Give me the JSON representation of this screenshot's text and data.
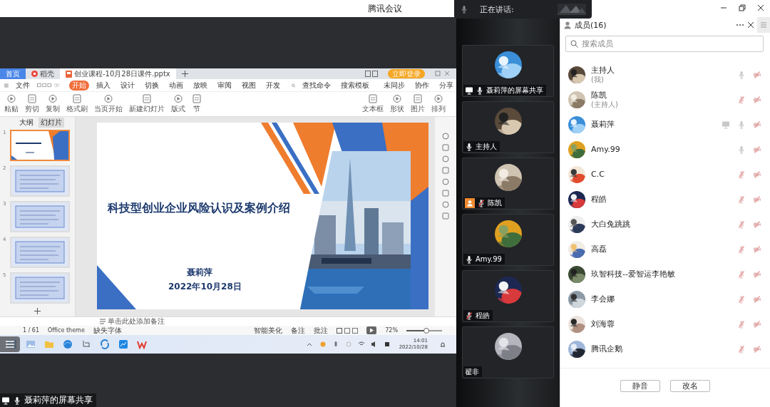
{
  "window": {
    "title": "腾讯会议",
    "speaking_label": "正在讲话:"
  },
  "share": {
    "label": "聂莉萍的屏幕共享",
    "tabs": [
      {
        "label": "首页",
        "kind": "home",
        "selected": false
      },
      {
        "label": "稻壳",
        "kind": "docer",
        "selected": false
      },
      {
        "label": "创业课程-10月28日课件.pptx",
        "kind": "file",
        "selected": true
      }
    ],
    "login_button": "立即登录",
    "menu": [
      {
        "label": "文件",
        "selected": false
      },
      {
        "label": "开始",
        "selected": true
      },
      {
        "label": "插入",
        "selected": false
      },
      {
        "label": "设计",
        "selected": false
      },
      {
        "label": "切换",
        "selected": false
      },
      {
        "label": "动画",
        "selected": false
      },
      {
        "label": "放映",
        "selected": false
      },
      {
        "label": "审阅",
        "selected": false
      },
      {
        "label": "视图",
        "selected": false
      },
      {
        "label": "开发",
        "selected": false
      }
    ],
    "search": [
      "查找命令",
      "搜索模板"
    ],
    "sync": [
      "未同步",
      "协作",
      "分享"
    ],
    "ribbon": [
      "粘贴",
      "剪切",
      "复制",
      "格式刷",
      "当页开始",
      "新建幻灯片",
      "版式",
      "节"
    ],
    "ribbon_right": [
      "文本框",
      "形状",
      "图片",
      "排列"
    ],
    "panel_tabs": [
      {
        "label": "大纲",
        "selected": false
      },
      {
        "label": "幻灯片",
        "selected": true
      }
    ],
    "thumbnails": [
      {
        "number": "1",
        "selected": true
      },
      {
        "number": "2",
        "selected": false
      },
      {
        "number": "3",
        "selected": false
      },
      {
        "number": "4",
        "selected": false
      },
      {
        "number": "5",
        "selected": false
      }
    ],
    "slide": {
      "title": "科技型创业企业风险认识及案例介绍",
      "author": "聂莉萍",
      "date": "2022年10月28日"
    },
    "notes_placeholder": "单击此处添加备注",
    "status": {
      "page": "1 / 61",
      "theme": "Office theme",
      "missing_fonts": "缺失字体",
      "beautify": "智能美化",
      "notes": "备注",
      "comments": "批注",
      "zoom": "72%"
    },
    "zoom_slider": {
      "level": 0.55
    },
    "taskbar": {
      "time": "14:01",
      "date": "2022/10/28"
    }
  },
  "tiles": [
    {
      "name": "聂莉萍的屏幕共享",
      "sharing": true,
      "host": false,
      "audio": true,
      "muted": false
    },
    {
      "name": "主持人",
      "sharing": false,
      "host": false,
      "audio": true,
      "muted": false
    },
    {
      "name": "陈凯",
      "sharing": false,
      "host": true,
      "audio": true,
      "muted": true
    },
    {
      "name": "Amy.99",
      "sharing": false,
      "host": false,
      "audio": true,
      "muted": false
    },
    {
      "name": "程皓",
      "sharing": false,
      "host": false,
      "audio": true,
      "muted": true
    },
    {
      "name": "翟非",
      "sharing": false,
      "host": false,
      "audio": false
    }
  ],
  "members": {
    "title": "成员(16)",
    "search": {
      "placeholder": "搜索成员"
    },
    "list": [
      {
        "name": "主持人",
        "note": "(我)",
        "sharing": false,
        "muted": false
      },
      {
        "name": "陈凯",
        "note": "(主持人)",
        "sharing": false,
        "muted": true
      },
      {
        "name": "聂莉萍",
        "sharing": true,
        "muted": false
      },
      {
        "name": "Amy.99",
        "sharing": false,
        "muted": false
      },
      {
        "name": "C.C",
        "sharing": false,
        "muted": true
      },
      {
        "name": "程皓",
        "sharing": false,
        "muted": true
      },
      {
        "name": "大白兔跳跳",
        "sharing": false,
        "muted": true
      },
      {
        "name": "高磊",
        "sharing": false,
        "muted": true
      },
      {
        "name": "玖智科技--爱智运李艳敏",
        "sharing": false,
        "muted": true
      },
      {
        "name": "李会娜",
        "sharing": false,
        "muted": true
      },
      {
        "name": "刘海蓉",
        "sharing": false,
        "muted": true
      },
      {
        "name": "腾讯企鹅",
        "sharing": false,
        "muted": true
      }
    ],
    "buttons": [
      "静音",
      "改名"
    ]
  }
}
